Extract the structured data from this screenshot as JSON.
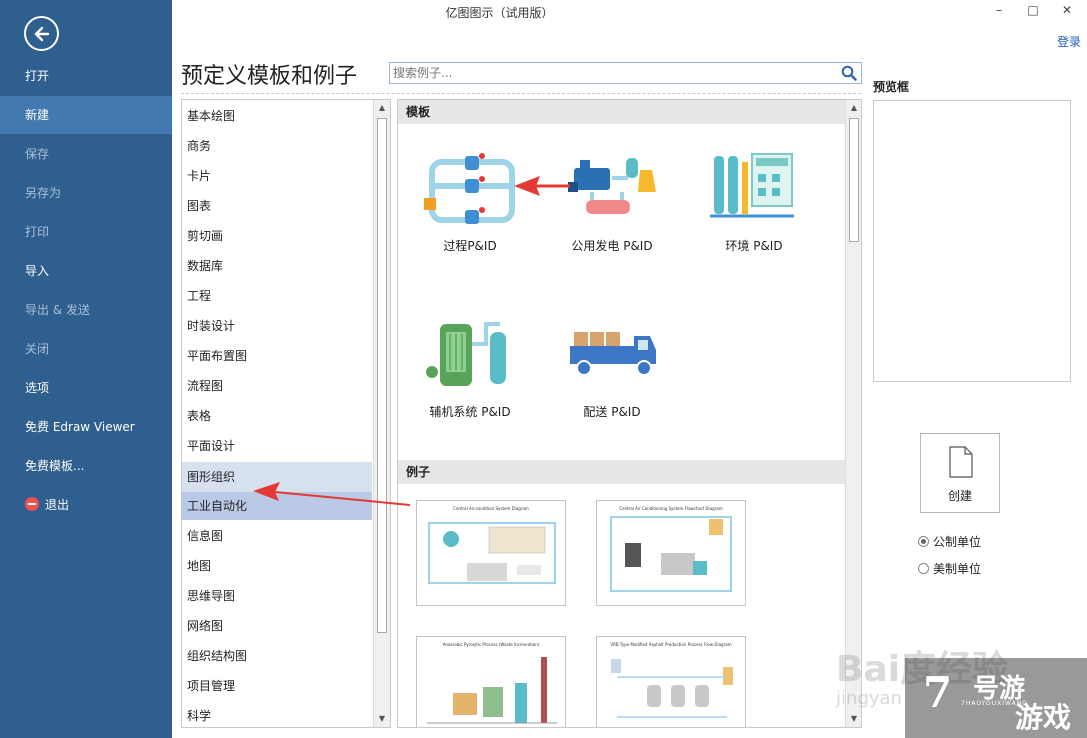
{
  "window": {
    "title": "亿图图示（试用版）",
    "login": "登录",
    "minimize": "–",
    "maximize": "□",
    "close": "✕"
  },
  "menu": {
    "items": [
      {
        "label": "打开",
        "state": "normal"
      },
      {
        "label": "新建",
        "state": "active"
      },
      {
        "label": "保存",
        "state": "disabled"
      },
      {
        "label": "另存为",
        "state": "disabled"
      },
      {
        "label": "打印",
        "state": "disabled"
      },
      {
        "label": "导入",
        "state": "normal"
      },
      {
        "label": "导出 & 发送",
        "state": "disabled"
      },
      {
        "label": "关闭",
        "state": "disabled"
      },
      {
        "label": "选项",
        "state": "normal"
      },
      {
        "label": "免费 Edraw Viewer",
        "state": "normal"
      },
      {
        "label": "免费模板...",
        "state": "normal"
      },
      {
        "label": "退出",
        "state": "normal"
      }
    ]
  },
  "page": {
    "title": "预定义模板和例子",
    "search_placeholder": "搜索例子..."
  },
  "categories": [
    "基本绘图",
    "商务",
    "卡片",
    "图表",
    "剪切画",
    "数据库",
    "工程",
    "时装设计",
    "平面布置图",
    "流程图",
    "表格",
    "平面设计",
    "图形组织",
    "工业自动化",
    "信息图",
    "地图",
    "思维导图",
    "网络图",
    "组织结构图",
    "项目管理",
    "科学"
  ],
  "selected_category": "工业自动化",
  "templates_section": {
    "heading": "模板",
    "items": [
      "过程P&ID",
      "公用发电 P&ID",
      "环境 P&ID",
      "辅机系统 P&ID",
      "配送 P&ID"
    ]
  },
  "examples_section": {
    "heading": "例子",
    "items": [
      {
        "title": "Central Air-condition System Diagram"
      },
      {
        "title": "Central Air Conditioning System Flowchart Diagram"
      },
      {
        "title": "Anaerobic Pyrolytic Process (Waste Incineration)"
      },
      {
        "title": "VRB Type Modified Asphalt Production Process Flow Diagram"
      }
    ]
  },
  "preview": {
    "label": "预览框",
    "create_label": "创建"
  },
  "units": {
    "options": [
      "公制单位",
      "美制单位"
    ],
    "selected": "公制单位"
  },
  "watermark": {
    "baidu": "Bai度经验",
    "jingyan": "jingyan",
    "logo_number": "7",
    "logo_text1": "号游",
    "logo_text2": "游戏",
    "logo_sub": "7HAOYOUXIWANG"
  },
  "colors": {
    "menu_bg": "#2f5f8f",
    "menu_active": "#4179b0",
    "selection": "#b9c9e6",
    "annotation_arrow": "#e53935"
  }
}
